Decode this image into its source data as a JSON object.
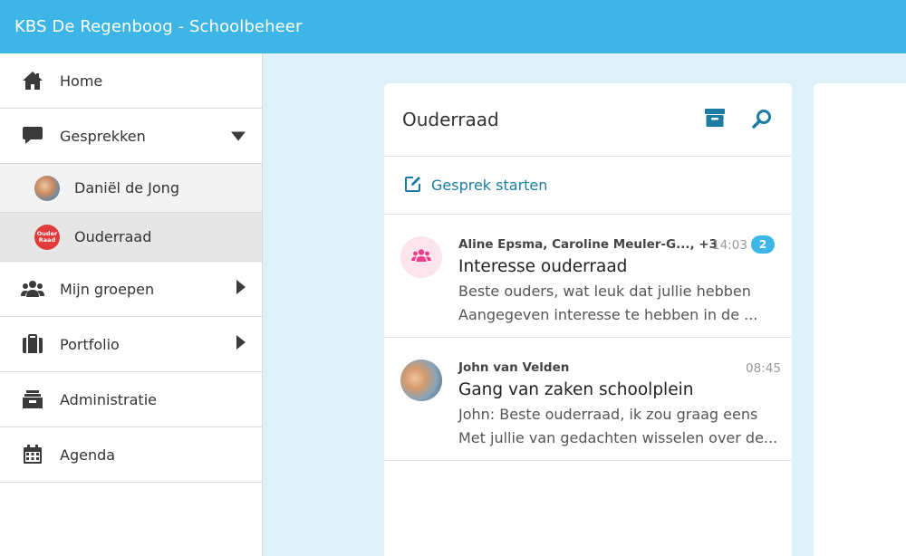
{
  "app": {
    "title": "KBS De Regenboog - Schoolbeheer"
  },
  "sidebar": {
    "items": [
      {
        "label": "Home",
        "icon": "home-icon"
      },
      {
        "label": "Gesprekken",
        "icon": "chat-icon",
        "expanded": true
      },
      {
        "label": "Mijn groepen",
        "icon": "groups-icon"
      },
      {
        "label": "Portfolio",
        "icon": "portfolio-icon"
      },
      {
        "label": "Administratie",
        "icon": "administration-icon"
      },
      {
        "label": "Agenda",
        "icon": "calendar-icon"
      }
    ],
    "subitems": [
      {
        "label": "Daniël de Jong"
      },
      {
        "label": "Ouderraad",
        "active": true,
        "avatar_text_1": "Ouder",
        "avatar_text_2": "Raad"
      }
    ]
  },
  "panel": {
    "title": "Ouderraad",
    "start_label": "Gesprek starten",
    "conversations": [
      {
        "names": "Aline Epsma, Caroline Meuler-G..., +3",
        "time": "14:03",
        "badge": "2",
        "subject": "Interesse ouderraad",
        "line1": "Beste ouders, wat leuk dat jullie hebben",
        "line2": "Aangegeven interesse te hebben in de ..."
      },
      {
        "names": "John van Velden",
        "time": "08:45",
        "subject": "Gang van zaken schoolplein",
        "line1": "John: Beste ouderraad, ik zou graag eens",
        "line2": "Met jullie van gedachten wisselen over de..."
      }
    ]
  },
  "colors": {
    "accent": "#3db5e6",
    "link": "#1c7ca3",
    "background": "#dff1f8"
  }
}
